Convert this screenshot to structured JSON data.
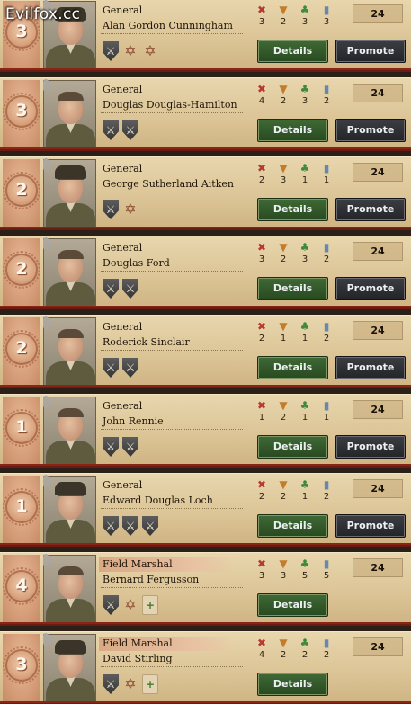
{
  "watermark": "Evilfox.cc",
  "buttons": {
    "details": "Details",
    "promote": "Promote"
  },
  "colors": {
    "card_bg": "#dcc597",
    "card_border": "#8a2416",
    "details_btn": "#3f6a36",
    "promote_btn": "#3c3e43",
    "attack": "#b73a32",
    "defense": "#c37c2a",
    "planning": "#3e8a3b",
    "logistics": "#6788ad"
  },
  "generals": [
    {
      "rank_num": "3",
      "title": "General",
      "name": "Alan Gordon Cunningham",
      "stats": {
        "attack": "3",
        "defense": "2",
        "planning": "3",
        "logistics": "3"
      },
      "level": "24",
      "traits": [
        "shield-trait",
        "medal-trait",
        "medal-trait"
      ],
      "promotable": true
    },
    {
      "rank_num": "3",
      "title": "General",
      "name": "Douglas Douglas-Hamilton",
      "stats": {
        "attack": "4",
        "defense": "2",
        "planning": "3",
        "logistics": "2"
      },
      "level": "24",
      "traits": [
        "shield-trait",
        "shield-trait"
      ],
      "promotable": true
    },
    {
      "rank_num": "2",
      "title": "General",
      "name": "George Sutherland Aitken",
      "stats": {
        "attack": "2",
        "defense": "3",
        "planning": "1",
        "logistics": "1"
      },
      "level": "24",
      "traits": [
        "shield-trait",
        "medal-trait"
      ],
      "promotable": true
    },
    {
      "rank_num": "2",
      "title": "General",
      "name": "Douglas Ford",
      "stats": {
        "attack": "3",
        "defense": "2",
        "planning": "3",
        "logistics": "2"
      },
      "level": "24",
      "traits": [
        "shield-trait",
        "shield-trait"
      ],
      "promotable": true
    },
    {
      "rank_num": "2",
      "title": "General",
      "name": "Roderick Sinclair",
      "stats": {
        "attack": "2",
        "defense": "1",
        "planning": "1",
        "logistics": "2"
      },
      "level": "24",
      "traits": [
        "shield-trait",
        "shield-trait"
      ],
      "promotable": true
    },
    {
      "rank_num": "1",
      "title": "General",
      "name": "John Rennie",
      "stats": {
        "attack": "1",
        "defense": "2",
        "planning": "1",
        "logistics": "1"
      },
      "level": "24",
      "traits": [
        "shield-trait",
        "shield-trait"
      ],
      "promotable": true
    },
    {
      "rank_num": "1",
      "title": "General",
      "name": "Edward Douglas Loch",
      "stats": {
        "attack": "2",
        "defense": "2",
        "planning": "1",
        "logistics": "2"
      },
      "level": "24",
      "traits": [
        "shield-trait",
        "shield-trait",
        "shield-trait"
      ],
      "promotable": true
    },
    {
      "rank_num": "4",
      "title": "Field Marshal",
      "name": "Bernard Fergusson",
      "stats": {
        "attack": "3",
        "defense": "3",
        "planning": "5",
        "logistics": "5"
      },
      "level": "24",
      "traits": [
        "shield-trait",
        "medal-trait",
        "add-trait-slot"
      ],
      "promotable": false
    },
    {
      "rank_num": "3",
      "title": "Field Marshal",
      "name": "David Stirling",
      "stats": {
        "attack": "4",
        "defense": "2",
        "planning": "2",
        "logistics": "2"
      },
      "level": "24",
      "traits": [
        "shield-trait",
        "medal-trait",
        "add-trait-slot"
      ],
      "promotable": false
    }
  ]
}
